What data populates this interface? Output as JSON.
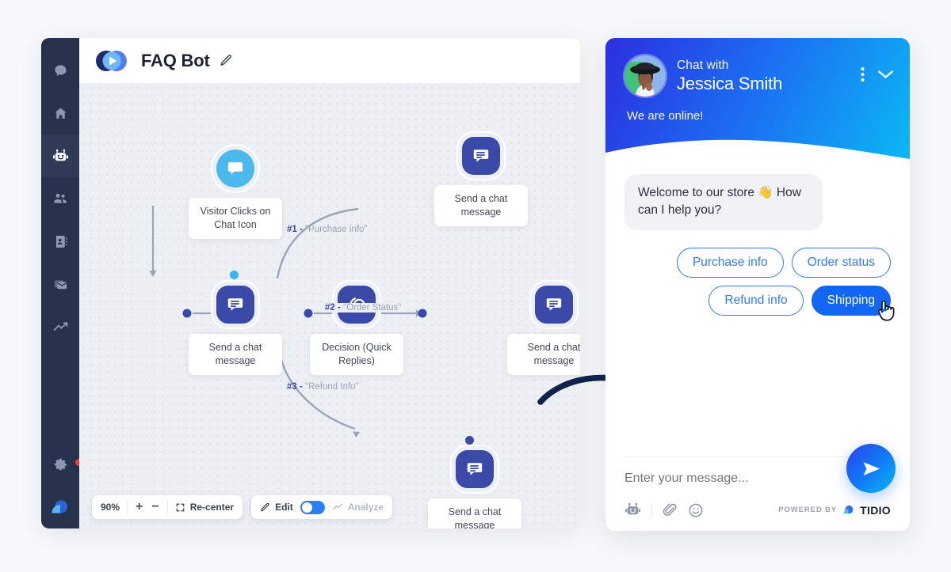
{
  "builder": {
    "title": "FAQ Bot",
    "edit_icon": "pencil-icon",
    "brand_icon": "tidio-play-logo",
    "sidebar": [
      {
        "name": "chat",
        "icon": "chat-bubble-icon",
        "active": false
      },
      {
        "name": "home",
        "icon": "home-icon",
        "active": false
      },
      {
        "name": "chatbots",
        "icon": "robot-icon",
        "active": true
      },
      {
        "name": "visitors",
        "icon": "people-icon",
        "active": false
      },
      {
        "name": "contacts",
        "icon": "contact-book-icon",
        "active": false
      },
      {
        "name": "email",
        "icon": "mail-icon",
        "active": false
      },
      {
        "name": "analytics",
        "icon": "trend-line-icon",
        "active": false
      },
      {
        "name": "settings",
        "icon": "gear-icon",
        "active": false
      }
    ],
    "nodes": [
      {
        "id": "trigger",
        "label": "Visitor Clicks on\nChat Icon",
        "icon": "chat-bubble-icon",
        "kind": "trigger"
      },
      {
        "id": "msg1",
        "label": "Send a chat\nmessage",
        "icon": "message-lines-icon",
        "kind": "action"
      },
      {
        "id": "decision",
        "label": "Decision (Quick\nReplies)",
        "icon": "decision-circles-icon",
        "kind": "action"
      },
      {
        "id": "msg_top",
        "label": "Send a chat\nmessage",
        "icon": "message-lines-icon",
        "kind": "action"
      },
      {
        "id": "msg_right",
        "label": "Send a chat\nmessage",
        "icon": "message-lines-icon",
        "kind": "action"
      },
      {
        "id": "msg_bottom",
        "label": "Send a chat\nmessage",
        "icon": "message-lines-icon",
        "kind": "action"
      }
    ],
    "wire_labels": [
      {
        "num": "#1 -",
        "text": "\"Purchase info\""
      },
      {
        "num": "#2 -",
        "text": "\"Order Status\""
      },
      {
        "num": "#3 -",
        "text": "\"Refund Info\""
      }
    ],
    "toolbar": {
      "zoom_level": "90%",
      "zoom_in": "+",
      "zoom_out": "−",
      "recenter_label": "Re-center",
      "recenter_icon": "recenter-icon",
      "edit_label": "Edit",
      "edit_icon": "pencil-icon",
      "edit_toggle_on": true,
      "analyze_label": "Analyze",
      "analyze_icon": "trend-line-icon"
    }
  },
  "widget": {
    "chat_with": "Chat with",
    "person": "Jessica Smith",
    "status": "We are online!",
    "menu_icon": "kebab-menu-icon",
    "collapse_icon": "chevron-down-icon",
    "avatar_icon": "avatar",
    "message": "Welcome to our store 👋\nHow can I help you?",
    "quick_replies": [
      {
        "label": "Purchase info",
        "selected": false
      },
      {
        "label": "Order status",
        "selected": false
      },
      {
        "label": "Refund info",
        "selected": false
      },
      {
        "label": "Shipping",
        "selected": true
      }
    ],
    "cursor_icon": "pointing-hand-cursor",
    "input_placeholder": "Enter your message...",
    "input_value": "",
    "footer_icons": [
      "robot-icon",
      "paperclip-icon",
      "smiley-icon"
    ],
    "powered_by": "POWERED BY",
    "brand": "TIDIO",
    "send_icon": "send-paper-plane-icon"
  },
  "colors": {
    "accent_blue": "#2f7df6",
    "node_blue": "#3b4aa8",
    "trigger_cyan": "#4cb9ec",
    "sidebar_dark": "#26324b",
    "canvas_bg": "#eceff4",
    "notification_red": "#ef3b3b"
  }
}
